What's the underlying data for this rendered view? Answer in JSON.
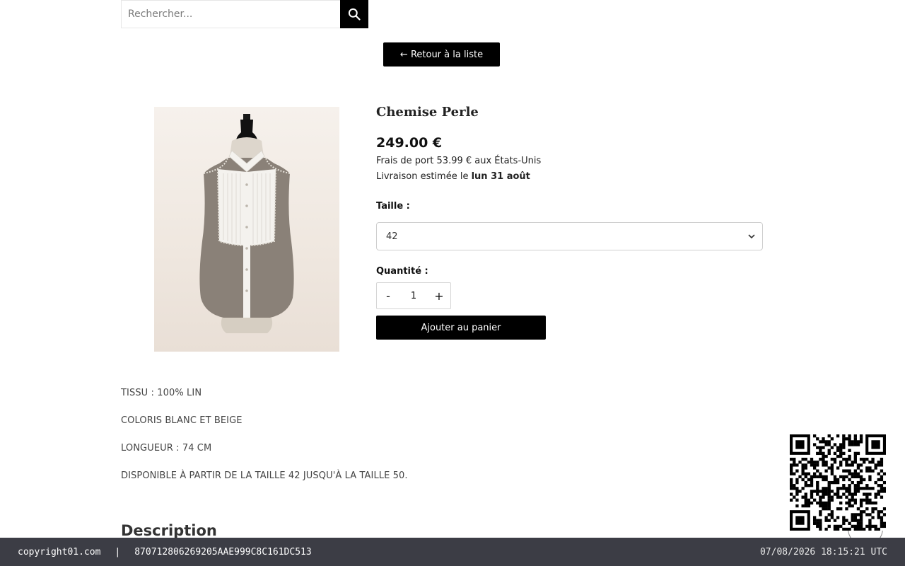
{
  "search": {
    "placeholder": "Rechercher..."
  },
  "nav": {
    "back_label": "← Retour à la liste"
  },
  "product": {
    "title": "Chemise Perle",
    "price": "249.00 €",
    "shipping": "Frais de port 53.99 € aux États-Unis",
    "delivery_prefix": "Livraison estimée le ",
    "delivery_date": "lun 31 août",
    "size_label": "Taille :",
    "size_selected": "42",
    "quantity_label": "Quantité :",
    "quantity_minus": "-",
    "quantity_value": "1",
    "quantity_plus": "+",
    "add_to_cart_label": "Ajouter au panier"
  },
  "details": {
    "lines": [
      "TISSU : 100% LIN",
      "COLORIS BLANC ET BEIGE",
      "LONGUEUR : 74 CM",
      "DISPONIBLE À PARTIR DE LA TAILLE 42 JUSQU'À LA TAILLE 50."
    ],
    "description_heading": "Description"
  },
  "footer": {
    "site": "copyright01.com",
    "separator": "|",
    "hash": "870712806269205AAE999C8C161DC513",
    "timestamp": "07/08/2026 18:15:21 UTC"
  },
  "icons": {
    "search": "search-icon",
    "chevron": "chevron-down-icon",
    "qr": "qr-code-icon"
  },
  "colors": {
    "button_bg": "#000000",
    "footer_bg": "#3c3d45",
    "garment_gray": "#8a8178",
    "bib_white": "#f4f2ee"
  }
}
